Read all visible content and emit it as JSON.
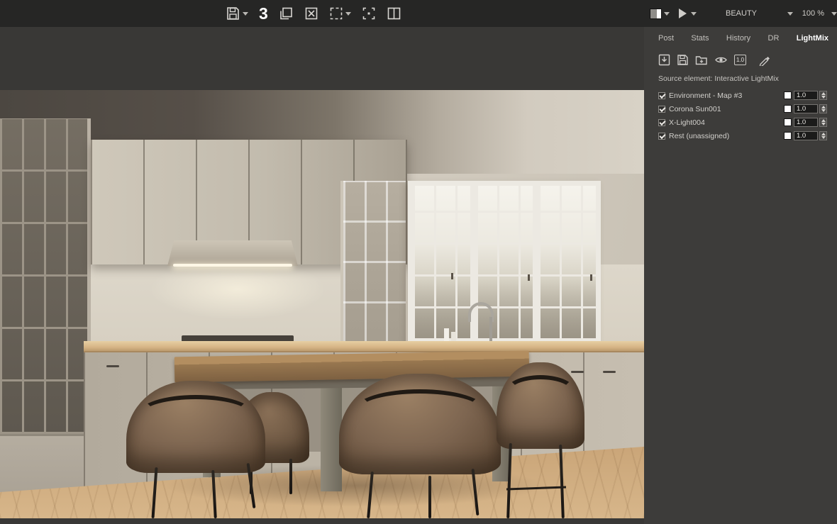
{
  "toolbar": {
    "history_count": "3",
    "icons": [
      "save-icon",
      "duplicate-icon",
      "clear-icon",
      "region-render-icon",
      "fit-view-icon",
      "compare-icon"
    ]
  },
  "render_controls": {
    "swatch_color": "#ffffff",
    "render_element": "BEAUTY",
    "zoom_level": "100 %"
  },
  "panel": {
    "tabs": [
      "Post",
      "Stats",
      "History",
      "DR",
      "LightMix"
    ],
    "active_tab": "LightMix",
    "icons": [
      "save-to-file-icon",
      "save-lightmix-icon",
      "load-lightmix-icon",
      "visibility-icon",
      "reset-values-badge",
      "pick-light-icon"
    ],
    "reset_badge": "1.0",
    "source_label": "Source element: Interactive LightMix",
    "layers": [
      {
        "name": "Environment - Map #3",
        "checked": true,
        "swatch_color": "#ffffff",
        "value": "1.0"
      },
      {
        "name": "Corona Sun001",
        "checked": true,
        "swatch_color": "#ffffff",
        "value": "1.0"
      },
      {
        "name": "X-Light004",
        "checked": true,
        "swatch_color": "#ffffff",
        "value": "1.0"
      },
      {
        "name": "Rest (unassigned)",
        "checked": true,
        "swatch_color": "#ffffff",
        "value": "1.0"
      }
    ]
  },
  "scene": {
    "description": "Interior render of a beige kitchen with island table, four brown chairs and a three-part window"
  }
}
